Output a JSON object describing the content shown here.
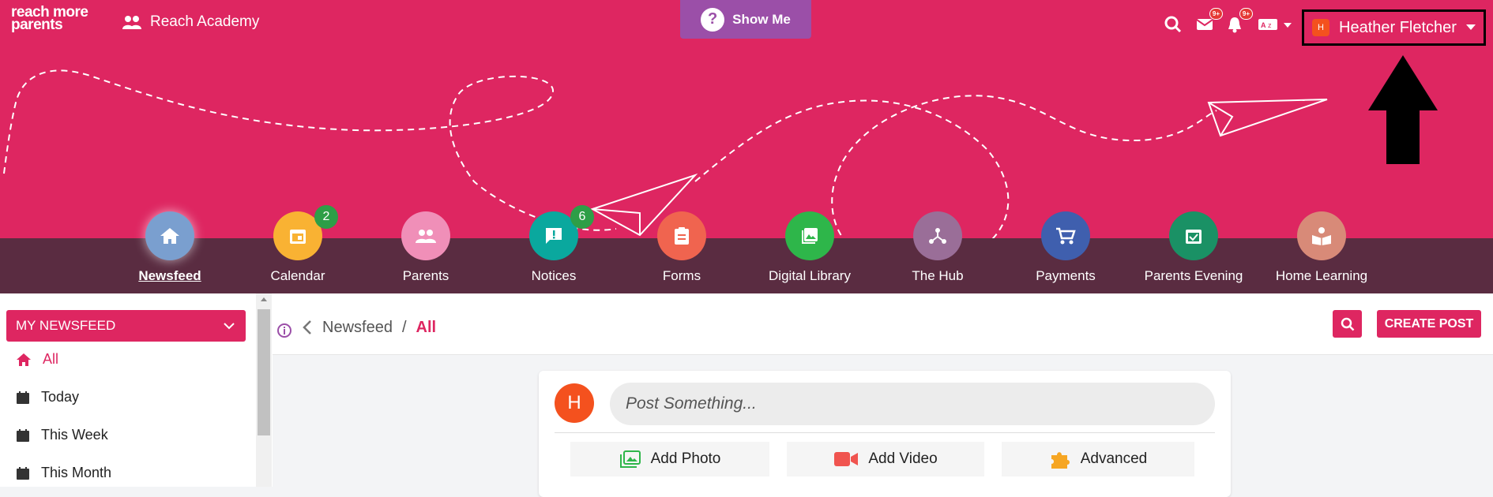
{
  "header": {
    "logo_line1": "reach more",
    "logo_line2": "parents",
    "school_name": "Reach Academy",
    "show_me_label": "Show Me",
    "mail_badge": "9+",
    "bell_badge": "9+",
    "user_initial": "H",
    "user_name": "Heather Fletcher"
  },
  "nav": {
    "items": [
      {
        "label": "Newsfeed",
        "color": "#7a9fcf",
        "icon": "home-icon"
      },
      {
        "label": "Calendar",
        "color": "#f9b233",
        "icon": "calendar-icon",
        "badge": "2"
      },
      {
        "label": "Parents",
        "color": "#f08fb8",
        "icon": "people-icon"
      },
      {
        "label": "Notices",
        "color": "#0aa89e",
        "icon": "notice-icon",
        "badge": "6"
      },
      {
        "label": "Forms",
        "color": "#f0644f",
        "icon": "clipboard-icon"
      },
      {
        "label": "Digital Library",
        "color": "#2eb64a",
        "icon": "photo-library-icon"
      },
      {
        "label": "The Hub",
        "color": "#9a6e98",
        "icon": "hub-icon"
      },
      {
        "label": "Payments",
        "color": "#3f5fae",
        "icon": "cart-icon"
      },
      {
        "label": "Parents Evening",
        "color": "#1a9165",
        "icon": "calendar-check-icon"
      },
      {
        "label": "Home Learning",
        "color": "#d88a78",
        "icon": "reading-icon"
      }
    ]
  },
  "sidebar": {
    "heading": "MY NEWSFEED",
    "items": [
      {
        "label": "All"
      },
      {
        "label": "Today"
      },
      {
        "label": "This Week"
      },
      {
        "label": "This Month"
      }
    ]
  },
  "breadcrumb": {
    "root": "Newsfeed",
    "sep": "/",
    "current": "All"
  },
  "actions": {
    "create_post": "CREATE POST"
  },
  "composer": {
    "avatar_initial": "H",
    "placeholder": "Post Something...",
    "buttons": [
      {
        "label": "Add Photo"
      },
      {
        "label": "Add Video"
      },
      {
        "label": "Advanced"
      }
    ]
  },
  "colors": {
    "brand": "#de2661",
    "band": "#5a2c41",
    "show_me": "#9b4fa8"
  }
}
